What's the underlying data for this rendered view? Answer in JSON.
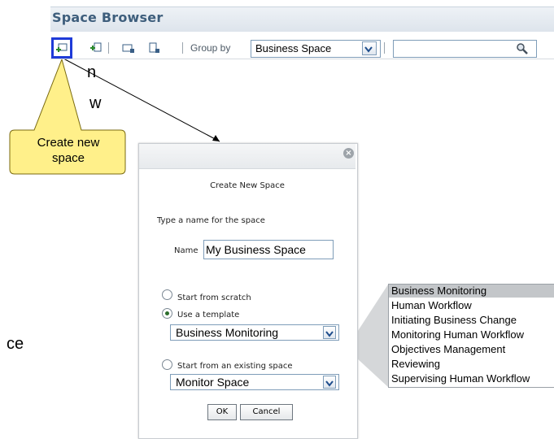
{
  "background_fragments": [
    "n",
    "w",
    "ce"
  ],
  "space_browser": {
    "title": "Space Browser",
    "group_by_label": "Group by",
    "group_by_value": "Business Space",
    "icons": [
      "create-space-icon",
      "add-space-icon",
      "copy-space-icon",
      "delete-space-icon",
      "search-icon"
    ]
  },
  "callout": {
    "text_line1": "Create new",
    "text_line2": "space",
    "color": "#FFF08A"
  },
  "dialog": {
    "title": "Create New Space",
    "prompt": "Type a name for the space",
    "name_label": "Name",
    "name_value": "My Business Space",
    "option_scratch": "Start from scratch",
    "option_template": "Use a template",
    "template_value": "Business Monitoring",
    "option_existing": "Start from an existing space",
    "existing_value": "Monitor Space",
    "ok_label": "OK",
    "cancel_label": "Cancel",
    "selected_option": "template"
  },
  "template_list": {
    "items": [
      "Business Monitoring",
      "Human Workflow",
      "Initiating Business Change",
      "Monitoring Human Workflow",
      "Objectives Management",
      "Reviewing",
      "Supervising Human Workflow"
    ],
    "selected_index": 0
  }
}
